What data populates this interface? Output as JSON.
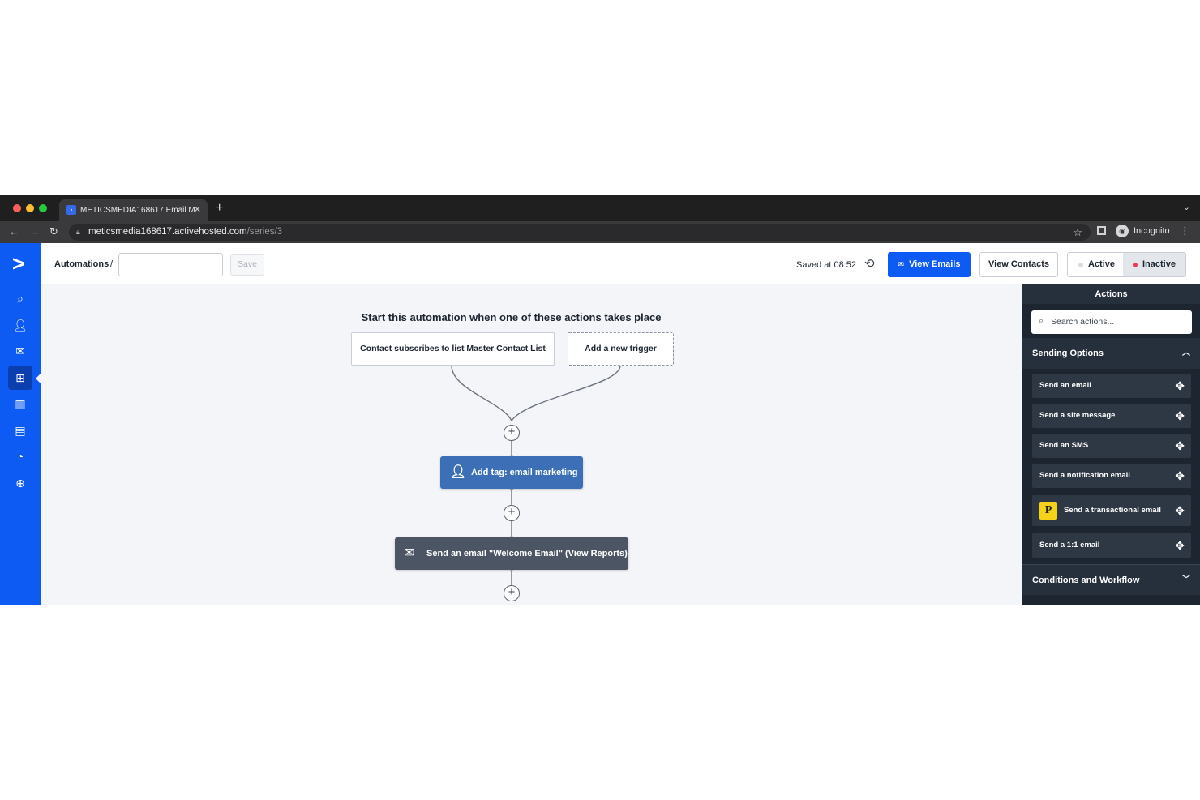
{
  "browser": {
    "tab_title": "METICSMEDIA168617 Email M",
    "tab_close": "✕",
    "new_tab": "+",
    "url_host": "meticsmedia168617.activehosted.com",
    "url_path": "/series/3",
    "profile": "Incognito"
  },
  "header": {
    "breadcrumb": "Automations",
    "separator": "/",
    "name_value": "",
    "save_label": "Save",
    "saved_status": "Saved at 08:52",
    "view_emails": "View Emails",
    "view_contacts": "View Contacts",
    "status_active": "Active",
    "status_inactive": "Inactive"
  },
  "canvas": {
    "title": "Start this automation when one of these actions takes place",
    "trigger_1": "Contact subscribes to list Master Contact List",
    "trigger_add": "Add a new trigger",
    "node_tag": "Add tag: email marketing",
    "node_email": "Send an email \"Welcome Email\" (View Reports)",
    "plus": "+"
  },
  "panel": {
    "title": "Actions",
    "search_placeholder": "Search actions...",
    "section_sending": "Sending Options",
    "section_conditions": "Conditions and Workflow",
    "actions": [
      "Send an email",
      "Send a site message",
      "Send an SMS",
      "Send a notification email",
      "Send a transactional email",
      "Send a 1:1 email"
    ],
    "badge_letter": "P"
  },
  "colors": {
    "nav_blue": "#0d5bf2",
    "tag_node": "#3d6fb6",
    "email_node": "#4b5563",
    "panel_dark": "#1d2530",
    "inactive_dot": "#e53b4f"
  }
}
